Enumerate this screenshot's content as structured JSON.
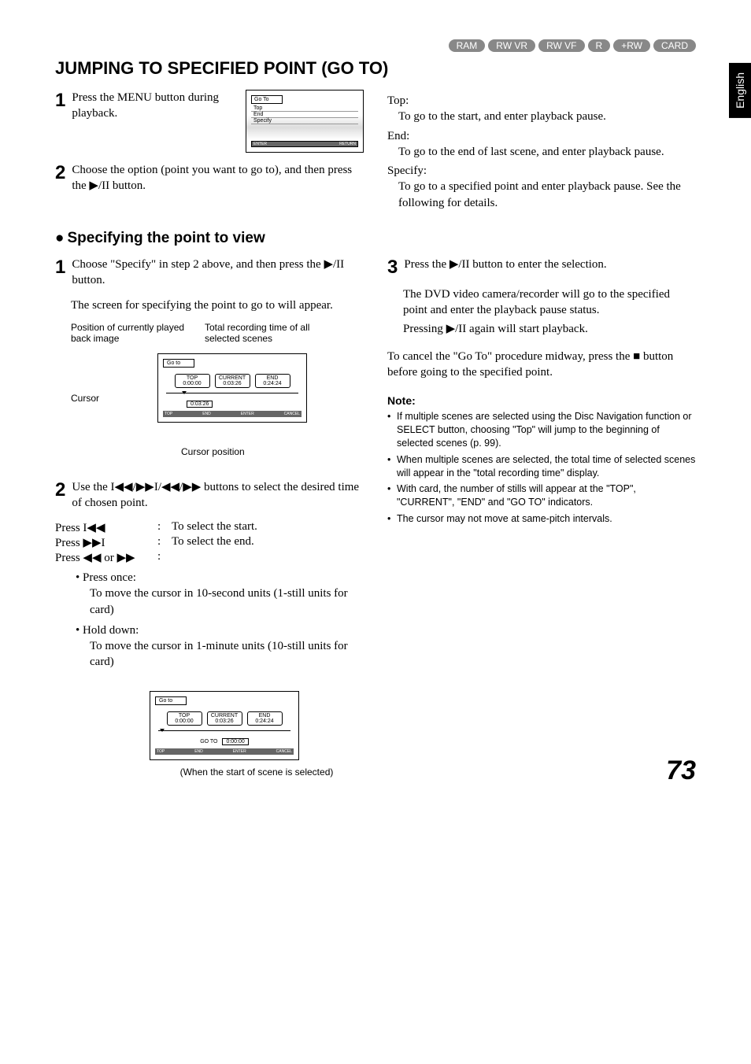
{
  "side_tab": "English",
  "badges": [
    "RAM",
    "RW VR",
    "RW VF",
    "R",
    "+RW",
    "CARD"
  ],
  "title": "JUMPING TO SPECIFIED POINT (GO TO)",
  "top_left": {
    "step1": "Press the MENU button during playback.",
    "step2": "Choose the option (point you want to go to), and then press the ▶/II button.",
    "screenshot": {
      "title": "Go To",
      "items": [
        "Top",
        "End",
        "Specify"
      ],
      "hint_enter": "ENTER",
      "hint_return": "RETURN"
    }
  },
  "top_right": {
    "top_label": "Top:",
    "top_def": "To go to the start, and enter playback pause.",
    "end_label": "End:",
    "end_def": "To go to the end of last scene, and enter playback pause.",
    "spec_label": "Specify:",
    "spec_def": "To go to a specified point and enter playback pause. See the following for details."
  },
  "subheading": "Specifying the point to view",
  "spec_left": {
    "step1a": "Choose \"Specify\" in step 2 above, and then press the ▶/II button.",
    "step1b": "The screen for specifying the point to go to will appear.",
    "lbl_pos": "Position of currently played back image",
    "lbl_total": "Total recording time of all selected scenes",
    "lbl_cursor": "Cursor",
    "lbl_cursorpos": "Cursor position",
    "goto_screen": {
      "title": "Go to",
      "top": "TOP",
      "top_time": "0:00:00",
      "current": "CURRENT",
      "current_time": "0:03:26",
      "end": "END",
      "end_time": "0:24:24",
      "goto_value": "0:03:26",
      "f_top": "TOP",
      "f_end": "END",
      "f_enter": "ENTER",
      "f_cancel": "CANCEL"
    },
    "step2": "Use the I◀◀/▶▶I/◀◀/▶▶ buttons to select the desired time of chosen point.",
    "press": [
      {
        "key": "Press I◀◀",
        "val": "To select the start."
      },
      {
        "key": "Press ▶▶I",
        "val": "To select the end."
      },
      {
        "key": "Press ◀◀ or ▶▶",
        "val": ""
      }
    ],
    "once_label": "• Press once:",
    "once_desc": "To move the cursor in 10-second units (1-still units for card)",
    "hold_label": "• Hold down:",
    "hold_desc": "To move the cursor in 1-minute units (10-still units for card)",
    "start_caption": "(When the start of scene is selected)",
    "start_screen": {
      "title": "Go to",
      "top": "TOP",
      "top_time": "0:00:00",
      "current": "CURRENT",
      "current_time": "0:03:26",
      "end": "END",
      "end_time": "0:24:24",
      "goto_label": "GO TO",
      "goto_value": "0:00:00",
      "f_top": "TOP",
      "f_end": "END",
      "f_enter": "ENTER",
      "f_cancel": "CANCEL"
    }
  },
  "spec_right": {
    "step3a": "Press the ▶/II button to enter the selection.",
    "step3b": "The DVD video camera/recorder will go to the specified point and enter the playback pause status.",
    "step3c": "Pressing ▶/II again will start playback.",
    "cancel": "To cancel the \"Go To\" procedure midway, press the ■ button before going to the specified point.",
    "note_head": "Note:",
    "notes": [
      "If multiple scenes are selected using the Disc Navigation function or SELECT button, choosing \"Top\" will jump to the beginning of selected scenes (p. 99).",
      "When multiple scenes are selected, the total time of selected scenes will appear in the \"total recording time\" display.",
      "With card, the number of stills will appear at the \"TOP\", \"CURRENT\", \"END\" and \"GO TO\" indicators.",
      "The cursor may not move at same-pitch intervals."
    ]
  },
  "page_number": "73"
}
